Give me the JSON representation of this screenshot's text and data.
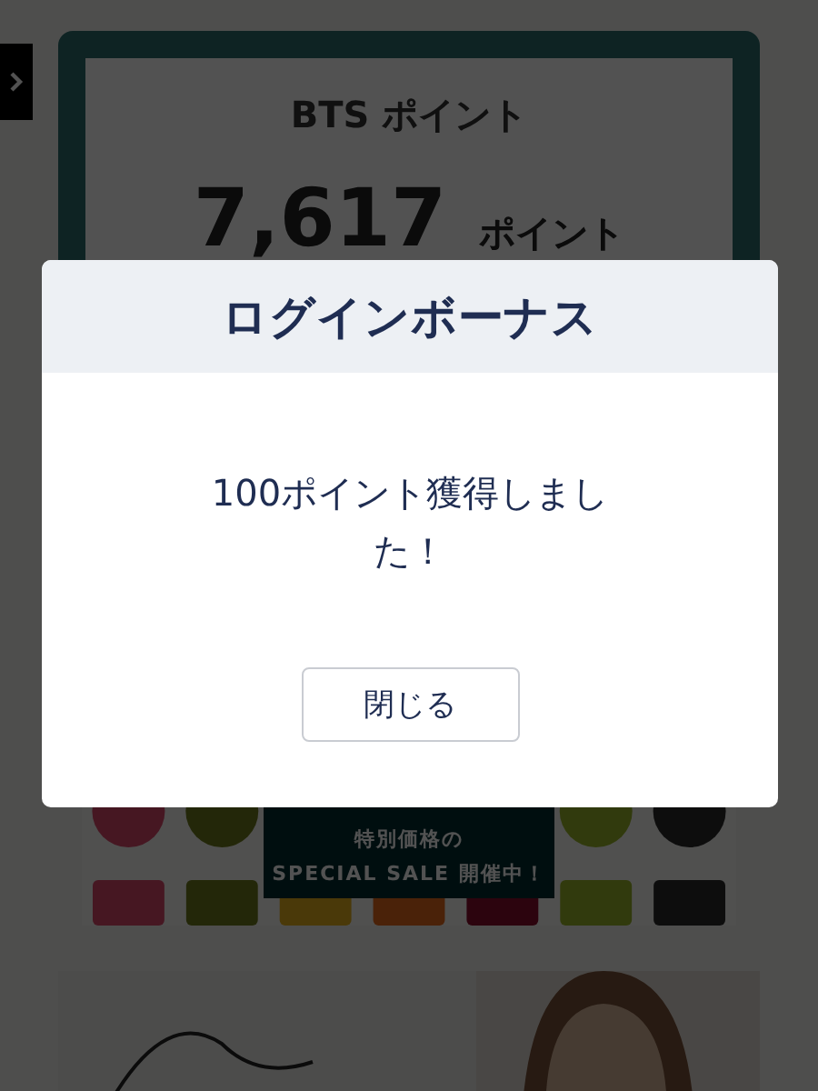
{
  "points_card": {
    "title": "BTS ポイント",
    "value": "7,617",
    "unit": "ポイント"
  },
  "sale_banner": {
    "lines": [
      "特別価格の",
      "SPECIAL SALE 開催中！"
    ]
  },
  "modal": {
    "title": "ログインボーナス",
    "message": "100ポイント獲得しました！",
    "button": "閉じる"
  }
}
